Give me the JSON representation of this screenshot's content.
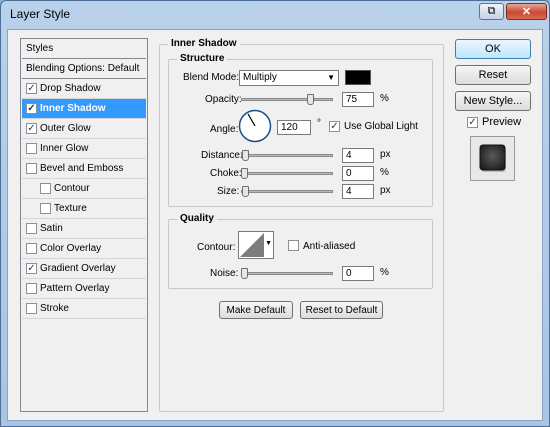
{
  "window": {
    "title": "Layer Style",
    "help_glyph": "⧉",
    "close_glyph": "✕"
  },
  "styles_list": {
    "header": "Styles",
    "items": [
      {
        "label": "Blending Options: Default",
        "checkbox": false,
        "checked": false,
        "selected": false,
        "indent": false,
        "header": true
      },
      {
        "label": "Drop Shadow",
        "checkbox": true,
        "checked": true,
        "selected": false,
        "indent": false
      },
      {
        "label": "Inner Shadow",
        "checkbox": true,
        "checked": true,
        "selected": true,
        "indent": false
      },
      {
        "label": "Outer Glow",
        "checkbox": true,
        "checked": true,
        "selected": false,
        "indent": false
      },
      {
        "label": "Inner Glow",
        "checkbox": true,
        "checked": false,
        "selected": false,
        "indent": false
      },
      {
        "label": "Bevel and Emboss",
        "checkbox": true,
        "checked": false,
        "selected": false,
        "indent": false
      },
      {
        "label": "Contour",
        "checkbox": true,
        "checked": false,
        "selected": false,
        "indent": true
      },
      {
        "label": "Texture",
        "checkbox": true,
        "checked": false,
        "selected": false,
        "indent": true
      },
      {
        "label": "Satin",
        "checkbox": true,
        "checked": false,
        "selected": false,
        "indent": false
      },
      {
        "label": "Color Overlay",
        "checkbox": true,
        "checked": false,
        "selected": false,
        "indent": false
      },
      {
        "label": "Gradient Overlay",
        "checkbox": true,
        "checked": true,
        "selected": false,
        "indent": false
      },
      {
        "label": "Pattern Overlay",
        "checkbox": true,
        "checked": false,
        "selected": false,
        "indent": false
      },
      {
        "label": "Stroke",
        "checkbox": true,
        "checked": false,
        "selected": false,
        "indent": false
      }
    ]
  },
  "inner_shadow": {
    "title": "Inner Shadow",
    "structure": {
      "title": "Structure",
      "blend_mode_label": "Blend Mode:",
      "blend_mode_value": "Multiply",
      "blend_color": "#000000",
      "opacity_label": "Opacity:",
      "opacity_value": "75",
      "opacity_unit": "%",
      "opacity_fraction": 0.75,
      "angle_label": "Angle:",
      "angle_value": "120",
      "angle_unit": "°",
      "use_global_light_label": "Use Global Light",
      "use_global_light_checked": true,
      "distance_label": "Distance:",
      "distance_value": "4",
      "distance_unit": "px",
      "choke_label": "Choke:",
      "choke_value": "0",
      "choke_unit": "%",
      "size_label": "Size:",
      "size_value": "4",
      "size_unit": "px"
    },
    "quality": {
      "title": "Quality",
      "contour_label": "Contour:",
      "anti_aliased_label": "Anti-aliased",
      "anti_aliased_checked": false,
      "noise_label": "Noise:",
      "noise_value": "0",
      "noise_unit": "%"
    },
    "make_default_label": "Make Default",
    "reset_to_default_label": "Reset to Default"
  },
  "right_panel": {
    "ok_label": "OK",
    "reset_label": "Reset",
    "new_style_label": "New Style...",
    "preview_label": "Preview",
    "preview_checked": true
  },
  "colors": {
    "selection": "#3399ff",
    "dialog_bg": "#f0f0f0"
  }
}
